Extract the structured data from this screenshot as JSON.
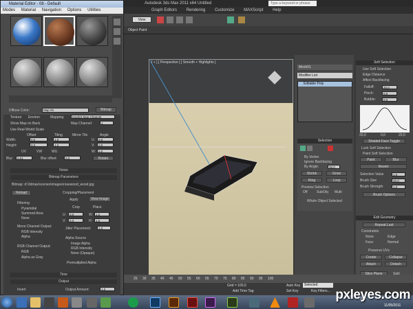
{
  "max": {
    "title": "Autodesk 3ds Max 2011 x64      Untitled",
    "search_placeholder": "Type a keyword or phrase",
    "menu": [
      "Graph Editors",
      "Rendering",
      "Customize",
      "MAXScript",
      "Help"
    ],
    "view_dropdown": "View",
    "object_paint": "Object Paint",
    "viewport_label": "[ + ] [ Perspective ] [ Smooth + Highlights ]"
  },
  "command_panel": {
    "object_name": "Mesh01",
    "modifier_list": "Modifier List",
    "stack_item": "Editable Poly",
    "selection": {
      "header": "Selection",
      "by_vertex": "By Vertex",
      "ignore_backfacing": "Ignore Backfacing",
      "by_angle": "By Angle:",
      "by_angle_value": "45,0",
      "shrink": "Shrink",
      "grow": "Grow",
      "ring": "Ring",
      "loop": "Loop",
      "preview_selection": "Preview Selection",
      "off": "Off",
      "subobj": "SubObj",
      "multi": "Multi",
      "whole_object": "Whole Object Selected"
    },
    "soft_selection": {
      "header": "Soft Selection",
      "use_soft": "Use Soft Selection",
      "edge_distance": "Edge Distance",
      "affect_backfacing": "Affect Backfacing",
      "falloff": "Falloff:",
      "pinch": "Pinch:",
      "bubble": "Bubble:",
      "falloff_val": "20,0",
      "pinch_val": "0,0",
      "bubble_val": "0,0",
      "curve_left": "20,0",
      "curve_mid": "0,0",
      "curve_right": "20,0",
      "shaded_face": "Shaded Face Toggle",
      "lock_soft": "Lock Soft Selection",
      "paint_soft": "Paint Soft Selection",
      "paint": "Paint",
      "blur": "Blur",
      "revert": "Revert",
      "selection_value": "Selection Value",
      "selection_value_num": "1,0",
      "brush_size": "Brush Size",
      "brush_size_num": "20,0",
      "brush_strength": "Brush Strength",
      "brush_strength_num": "1,0",
      "brush_options": "Brush Options"
    },
    "edit_geometry": {
      "header": "Edit Geometry",
      "repeat_last": "Repeat Last",
      "constraints": "Constraints",
      "none": "None",
      "edge": "Edge",
      "face": "Face",
      "normal": "Normal",
      "preserve_uvs": "Preserve UVs",
      "create": "Create",
      "collapse": "Collapse",
      "attach": "Attach",
      "detach": "Detach",
      "slice_plane": "Slice Plane",
      "split": "Split"
    }
  },
  "timeline": {
    "ticks": [
      "25",
      "30",
      "35",
      "40",
      "45",
      "50",
      "55",
      "60",
      "65",
      "70",
      "75",
      "80",
      "85",
      "90",
      "95",
      "100"
    ],
    "grid": "Grid = 100,0",
    "auto_key": "Auto Key",
    "selected": "Selected",
    "set_key": "Set Key",
    "key_filters": "Key Filters...",
    "add_time_tag": "Add Time Tag"
  },
  "material_editor": {
    "title": "Material Editor - 08 - Default",
    "menu": [
      "Modes",
      "Material",
      "Navigation",
      "Options",
      "Utilities"
    ],
    "diffuse_color": "Diffuse Color:",
    "map_name": "Map #5",
    "bitmap": "Bitmap",
    "texture": "Texture",
    "environ": "Environ",
    "mapping_label": "Mapping:",
    "mapping_value": "Explicit Map Channel",
    "show_map_on_back": "Show Map on Back",
    "map_channel": "Map Channel:",
    "map_channel_val": "1",
    "use_real_world": "Use Real-World Scale",
    "offset": "Offset",
    "tiling": "Tiling",
    "mirror_tile": "Mirror Tile",
    "angle": "Angle",
    "width": "Width:",
    "height": "Height:",
    "u": "U:",
    "v": "V:",
    "w": "W:",
    "zero": "0,0",
    "one": "1,0",
    "uv": "UV",
    "vw": "VW",
    "wu": "WU",
    "blur": "Blur:",
    "blur_val": "0,01",
    "blur_offset": "Blur offset:",
    "blur_offset_val": "0,0",
    "rotate": "Rotate",
    "noise": "Noise",
    "bitmap_params": "Bitmap Parameters",
    "bitmap_path": "Bitmap:  d:\\3dmax\\scenes\\images\\rosewood_wood.jpg",
    "reload": "Reload",
    "cropping": "Cropping/Placement",
    "apply": "Apply",
    "view_image": "View Image",
    "crop": "Crop",
    "place": "Place",
    "filtering": "Filtering",
    "pyramidal": "Pyramidal",
    "summed_area": "Summed Area",
    "none": "None",
    "mono_output": "Mono Channel Output:",
    "rgb_intensity": "RGB Intensity",
    "alpha": "Alpha",
    "rgb_output": "RGB Channel Output:",
    "rgb": "RGB",
    "alpha_as_gray": "Alpha as Gray",
    "jitter": "Jitter Placement:",
    "jitter_val": "1,0",
    "alpha_source": "Alpha Source",
    "image_alpha": "Image Alpha",
    "rgb_intensity2": "RGB Intensity",
    "none_opaque": "None (Opaque)",
    "premult": "Premultiplied Alpha",
    "crop_u": "U:",
    "crop_v": "V:",
    "crop_w": "W:",
    "crop_h": "H:",
    "crop_u_val": "0,0",
    "crop_v_val": "0,0",
    "crop_w_val": "1,0",
    "crop_h_val": "1,0",
    "time": "Time",
    "output": "Output",
    "invert": "Invert",
    "output_amount": "Output Amount:",
    "output_amount_val": "1,0"
  },
  "taskbar": {
    "clock": "13:36",
    "date": "11/05/2011"
  },
  "watermark": "pxleyes.com"
}
